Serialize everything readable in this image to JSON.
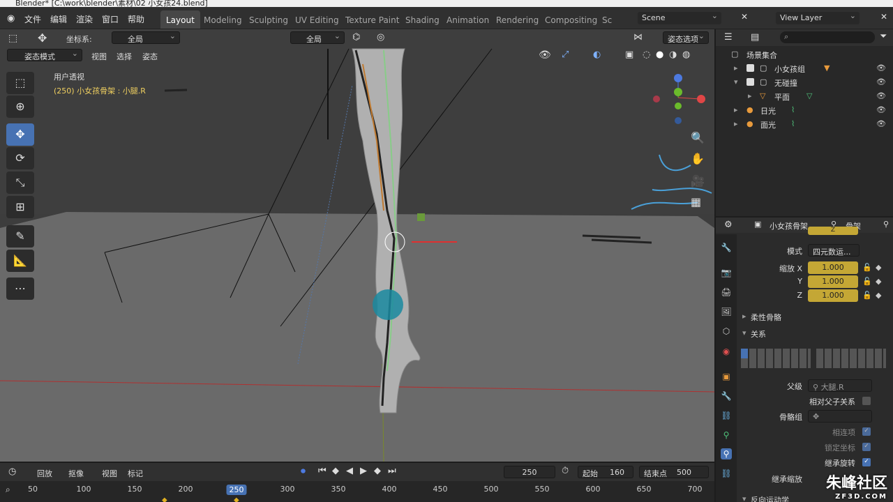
{
  "window": {
    "title": "Blender* [C:\\work\\blender\\素材\\02 小女孩24.blend]"
  },
  "menus": [
    "文件",
    "编辑",
    "渲染",
    "窗口",
    "帮助"
  ],
  "workspaces": [
    "Layout",
    "Modeling",
    "Sculpting",
    "UV Editing",
    "Texture Paint",
    "Shading",
    "Animation",
    "Rendering",
    "Compositing",
    "Sc"
  ],
  "scene": {
    "label": "Scene",
    "view_layer": "View Layer"
  },
  "viewport": {
    "transform_label": "坐标系:",
    "orientation": "全局",
    "pivot": "全局",
    "pose_options": "姿态选项",
    "mode": "姿态模式",
    "menu": [
      "视图",
      "选择",
      "姿态"
    ],
    "overlay_title": "用户透视",
    "overlay_sub": "(250) 小女孩骨架 : 小腿.R"
  },
  "outliner": {
    "root": "场景集合",
    "items": [
      {
        "label": "小女孩组"
      },
      {
        "label": "无碰撞"
      },
      {
        "label": "平面"
      },
      {
        "label": "日光"
      },
      {
        "label": "面光"
      }
    ]
  },
  "properties": {
    "context_object": "小女孩骨架",
    "context_data": "骨架",
    "top_cut": "Z",
    "mode_label": "模式",
    "mode_value": "四元数运...",
    "scale_label_x": "缩放 X",
    "scale_label_y": "Y",
    "scale_label_z": "Z",
    "scale_x": "1.000",
    "scale_y": "1.000",
    "scale_z": "1.000",
    "panel_bbone": "柔性骨骼",
    "panel_relations": "关系",
    "parent_label": "父级",
    "parent_value": "大腿.R",
    "relative_parent": "相对父子关系",
    "bone_group": "骨骼组",
    "connected": "相连项",
    "lock_location": "锁定坐标",
    "inherit_rotation": "继承旋转",
    "inherit_scale": "继承缩放",
    "panel_ik": "反向运动学"
  },
  "timeline": {
    "menu": [
      "回放",
      "抠像",
      "视图",
      "标记"
    ],
    "current_frame": "250",
    "start_label": "起始",
    "start": "160",
    "end_label": "结束点",
    "end": "500",
    "ruler": [
      "50",
      "100",
      "150",
      "200",
      "250",
      "300",
      "350",
      "400",
      "450",
      "500",
      "550",
      "600",
      "650",
      "700"
    ]
  },
  "watermark": {
    "brand": "朱峰社区",
    "site": "ZF3D.COM"
  }
}
